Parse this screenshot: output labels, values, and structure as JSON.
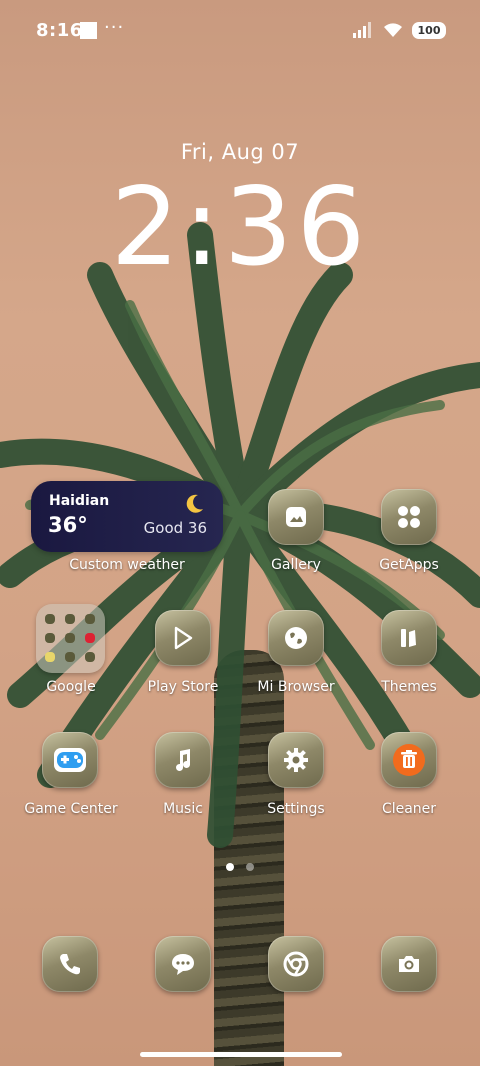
{
  "status_bar": {
    "time": "8:16",
    "overflow": "···",
    "battery": "100"
  },
  "lockclock": {
    "date": "Fri, Aug 07",
    "time": "2:36"
  },
  "weather_widget": {
    "city": "Haidian",
    "temperature": "36°",
    "air_quality": "Good 36",
    "label": "Custom weather"
  },
  "apps": {
    "gallery": "Gallery",
    "getapps": "GetApps",
    "google": "Google",
    "playstore": "Play Store",
    "browser": "Mi Browser",
    "themes": "Themes",
    "gamecenter": "Game Center",
    "music": "Music",
    "settings": "Settings",
    "cleaner": "Cleaner"
  },
  "dock": [
    "phone-icon",
    "messages-icon",
    "chrome-icon",
    "camera-icon"
  ],
  "pager": {
    "pages": 2,
    "current": 1
  }
}
